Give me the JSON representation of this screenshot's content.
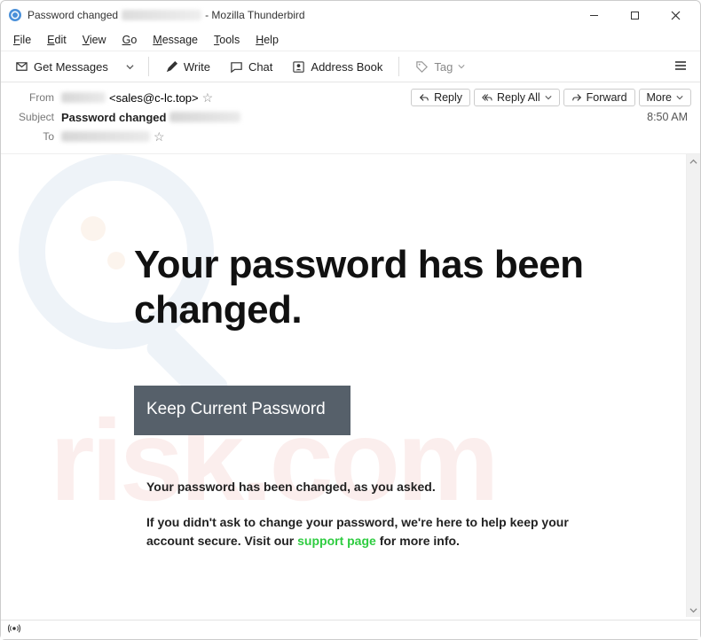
{
  "window": {
    "title_prefix": "Password changed",
    "title_suffix": " - Mozilla Thunderbird"
  },
  "menu": {
    "file": "File",
    "edit": "Edit",
    "view": "View",
    "go": "Go",
    "message": "Message",
    "tools": "Tools",
    "help": "Help"
  },
  "toolbar": {
    "get_messages": "Get Messages",
    "write": "Write",
    "chat": "Chat",
    "address_book": "Address Book",
    "tag": "Tag"
  },
  "header": {
    "from_label": "From",
    "from_value": "<sales@c-lc.top>",
    "subject_label": "Subject",
    "subject_value": "Password changed",
    "to_label": "To",
    "time": "8:50 AM",
    "actions": {
      "reply": "Reply",
      "reply_all": "Reply All",
      "forward": "Forward",
      "more": "More"
    }
  },
  "email": {
    "headline": "Your password has been changed.",
    "cta": "Keep Current Password",
    "p1": "Your password has been changed, as you asked.",
    "p2a": "If you didn't ask to change your password, we're here to help keep your account secure. Visit our ",
    "p2_link": "support page",
    "p2b": " for more info."
  },
  "watermark_text": "risk.com"
}
